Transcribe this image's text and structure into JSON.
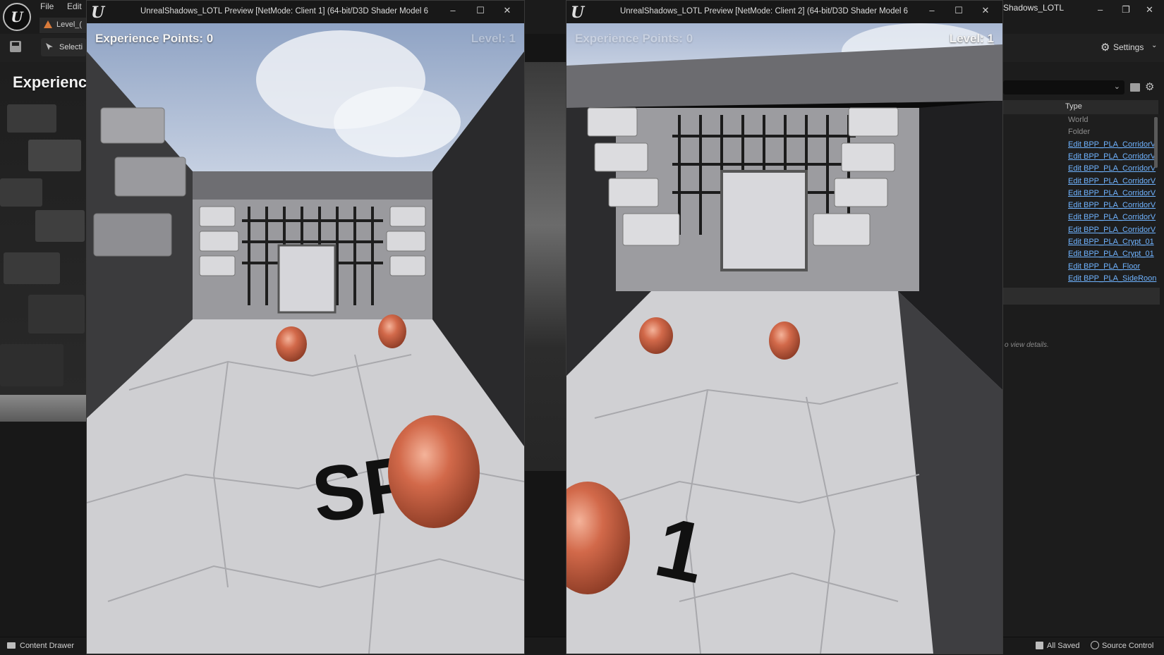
{
  "editor": {
    "logo_glyph": "U",
    "menu": [
      "File",
      "Edit"
    ],
    "level_tab": "Level_(",
    "select_button": "Selecti",
    "left_hud_text": "Experienc",
    "right_title": "Shadows_LOTL",
    "window_controls": [
      "–",
      "❐",
      "✕"
    ],
    "settings_label": "Settings",
    "settings_gear_glyph": "⚙",
    "chevron_glyph": "⌄",
    "cog_glyph": "⚙",
    "outliner": {
      "column_type": "Type",
      "rows": [
        {
          "type": "World",
          "style": "muted"
        },
        {
          "type": "Folder",
          "style": "muted"
        },
        {
          "type": "Edit BPP_PLA_CorridorV",
          "style": "link"
        },
        {
          "type": "Edit BPP_PLA_CorridorV",
          "style": "link"
        },
        {
          "type": "Edit BPP_PLA_CorridorV",
          "style": "link"
        },
        {
          "type": "Edit BPP_PLA_CorridorV",
          "style": "link"
        },
        {
          "type": "Edit BPP_PLA_CorridorV",
          "style": "link"
        },
        {
          "type": "Edit BPP_PLA_CorridorV",
          "style": "link"
        },
        {
          "type": "Edit BPP_PLA_CorridorV",
          "style": "link"
        },
        {
          "type": "Edit BPP_PLA_CorridorV",
          "style": "link"
        },
        {
          "type": "Edit BPP_PLA_Crypt_01",
          "style": "link"
        },
        {
          "type": "Edit BPP_PLA_Crypt_01",
          "style": "link"
        },
        {
          "type": "Edit BPP_PLA_Floor",
          "style": "link"
        },
        {
          "type": "Edit BPP_PLA_SideRoon",
          "style": "link"
        }
      ]
    },
    "details_hint": "o view details.",
    "status": {
      "content_drawer": "Content Drawer",
      "all_saved": "All Saved",
      "source_control": "Source Control"
    }
  },
  "pie_windows": [
    {
      "title": "UnrealShadows_LOTL Preview [NetMode: Client 1]  (64-bit/D3D Shader Model 6",
      "hud_xp": "Experience Points: 0",
      "hud_level": "Level: 1",
      "floor_text": "SP"
    },
    {
      "title": "UnrealShadows_LOTL Preview [NetMode: Client 2]  (64-bit/D3D Shader Model 6",
      "hud_xp": "Experience Points: 0",
      "hud_level": "Level: 1",
      "floor_text": "1"
    }
  ],
  "pie_window_controls": [
    "–",
    "☐",
    "✕"
  ],
  "pie_logo_glyph": "U",
  "colors": {
    "character": "#d2694a",
    "floor": "#cfcfd2",
    "wall": "#8d8d90",
    "sky": "#b7c6e0",
    "outliner_link": "#6fb3ff"
  }
}
